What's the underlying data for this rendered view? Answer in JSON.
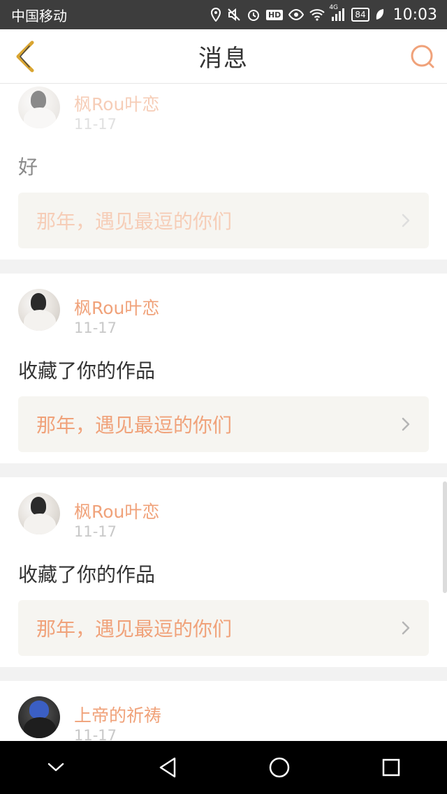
{
  "status_bar": {
    "carrier": "中国移动",
    "network": "4G",
    "battery": "84",
    "time": "10:03",
    "hd": "HD"
  },
  "header": {
    "title": "消息",
    "accent_color": "#f0a27a"
  },
  "messages": [
    {
      "user": "枫Rou叶恋",
      "date": "11-17",
      "text": "好",
      "work": "那年，遇见最逗的你们"
    },
    {
      "user": "枫Rou叶恋",
      "date": "11-17",
      "text": "收藏了你的作品",
      "work": "那年，遇见最逗的你们"
    },
    {
      "user": "枫Rou叶恋",
      "date": "11-17",
      "text": "收藏了你的作品",
      "work": "那年，遇见最逗的你们"
    },
    {
      "user": "上帝的祈祷",
      "date": "11-17"
    }
  ],
  "nav_bar": {
    "buttons": [
      "collapse-icon",
      "back-triangle-icon",
      "home-circle-icon",
      "recents-square-icon"
    ]
  }
}
